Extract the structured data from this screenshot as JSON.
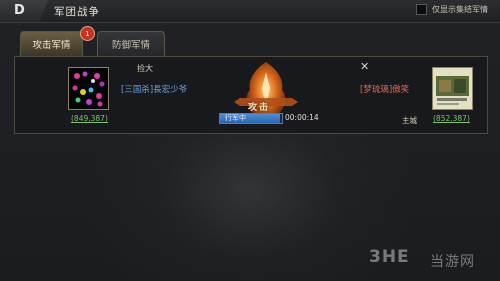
{
  "header": {
    "title": "军团战争",
    "back_glyph": "D",
    "filter_label": "仅显示集结军情",
    "filter_checked": false
  },
  "tabs": [
    {
      "label": "攻击军情",
      "active": true,
      "badge": "1"
    },
    {
      "label": "防御军情",
      "active": false
    }
  ],
  "report": {
    "group_name": "捡大",
    "close_glyph": "✕",
    "attacker": {
      "name": "[三国杀]長宏少爷",
      "power": "(849,387)"
    },
    "defender": {
      "name": "[梦琉璃]傲笑",
      "power": "(852,387)",
      "target_type": "主城"
    },
    "action_label": "攻击",
    "status": {
      "label": "行军中",
      "progress": 0.97,
      "timer": "00:00:14"
    }
  },
  "watermark": {
    "logo": "3HE",
    "text": "当游网"
  },
  "colors": {
    "attacker_name": "#6fa2e6",
    "defender_name": "#e06b56",
    "power": "#7ec36b",
    "progress": "#3a7fcf"
  },
  "icons": {
    "back": "back-arrow-icon",
    "close": "close-icon",
    "emblem": "fire-lantern-emblem-icon"
  }
}
